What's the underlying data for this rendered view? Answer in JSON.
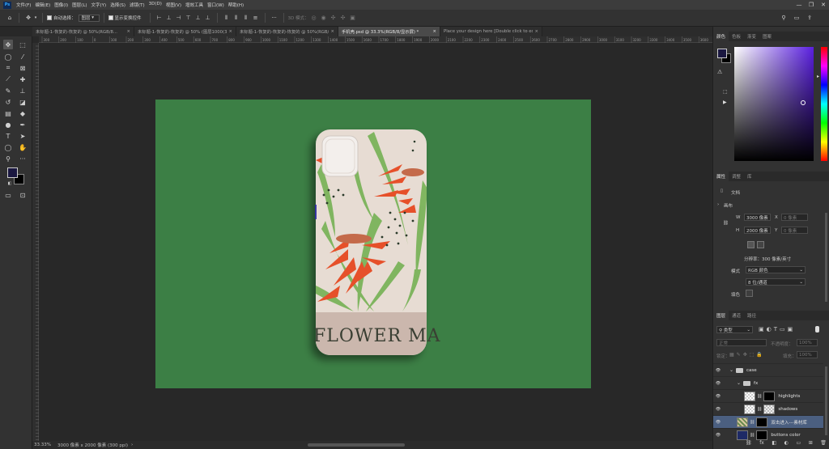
{
  "app": {
    "logo": "Ps"
  },
  "menu": [
    "文件(F)",
    "编辑(E)",
    "图像(I)",
    "图层(L)",
    "文字(Y)",
    "选择(S)",
    "滤镜(T)",
    "3D(D)",
    "视图(V)",
    "增效工具",
    "窗口(W)",
    "帮助(H)"
  ],
  "window_controls": {
    "minimize": "—",
    "restore": "❐",
    "close": "✕"
  },
  "options": {
    "auto_select_label": "自动选择：",
    "auto_select_value": "图层",
    "show_transform_label": "显示变换控件",
    "mode_3d_label": "3D 模式："
  },
  "tabs": [
    {
      "label": "未标题-1-恢复的-恢复的 @ 50%(RGB/8...",
      "close": "×",
      "active": false
    },
    {
      "label": "未标题-1-恢复的-恢复的 @ 50% (图层1000(3), R...",
      "close": "×",
      "active": false
    },
    {
      "label": "未标题-1-恢复的-恢复的-恢复的 @ 50%(RGB/8...",
      "close": "×",
      "active": false
    },
    {
      "label": "手机壳.psd @ 33.3%(RGB/8/显示屏) *",
      "close": "×",
      "active": true
    },
    {
      "label": "Place your design here [Double click to edit]13121.psb @...",
      "close": "×",
      "active": false
    }
  ],
  "ruler_ticks": [
    "300",
    "200",
    "100",
    "0",
    "100",
    "200",
    "300",
    "400",
    "500",
    "600",
    "700",
    "800",
    "900",
    "1000",
    "1100",
    "1200",
    "1300",
    "1400",
    "1500",
    "1600",
    "1700",
    "1800",
    "1900",
    "2000",
    "2100",
    "2200",
    "2300",
    "2400",
    "2500",
    "2600",
    "2700",
    "2800",
    "2900",
    "3000",
    "3100",
    "3200",
    "3300",
    "3400",
    "3500",
    "3600"
  ],
  "canvas": {
    "bg_color": "#3c7f45",
    "phone_text": "FLOWER MA",
    "case_color": "#e7dcd3"
  },
  "status": {
    "zoom": "33.33%",
    "doc_info": "3000 像素 x 2000 像素 (300 ppi)"
  },
  "color_panel": {
    "tabs": [
      "颜色",
      "色板",
      "渐变",
      "图案"
    ],
    "fg_color": "#1a1740",
    "bg_color": "#000000"
  },
  "properties_panel": {
    "tabs": [
      "属性",
      "调整",
      "库"
    ],
    "doc_label": "文档",
    "canvas_label": "画布",
    "w_label": "W",
    "w_value": "3000 像素",
    "x_label": "X",
    "x_value": "0 像素",
    "h_label": "H",
    "h_value": "2000 像素",
    "y_label": "Y",
    "y_value": "0 像素",
    "resolution": "分辨率：300 像素/英寸",
    "mode_label": "模式",
    "mode_value": "RGB 颜色",
    "depth_value": "8 位/通道",
    "fill_label": "填色"
  },
  "layers_panel": {
    "tabs": [
      "图层",
      "通道",
      "路径"
    ],
    "filter_value": "类型",
    "blend_value": "正常",
    "opacity_label": "不透明度：",
    "opacity_value": "100%",
    "lock_label": "锁定：",
    "fill_label": "填充：",
    "fill_value": "100%",
    "layers": [
      {
        "name": "case",
        "kind": "group",
        "indent": 0,
        "selected": false
      },
      {
        "name": "fx",
        "kind": "group",
        "indent": 1,
        "selected": false
      },
      {
        "name": "highlights",
        "kind": "layer",
        "indent": 2,
        "selected": false
      },
      {
        "name": "shadows",
        "kind": "layer",
        "indent": 2,
        "selected": false
      },
      {
        "name": "双击进入---素材库",
        "kind": "smart",
        "indent": 1,
        "selected": true
      },
      {
        "name": "buttons color",
        "kind": "layer",
        "indent": 1,
        "selected": false
      }
    ],
    "footer_icons": [
      "link-icon",
      "fx-icon",
      "mask-icon",
      "adjustment-icon",
      "folder-icon",
      "new-layer-icon",
      "trash-icon"
    ]
  }
}
